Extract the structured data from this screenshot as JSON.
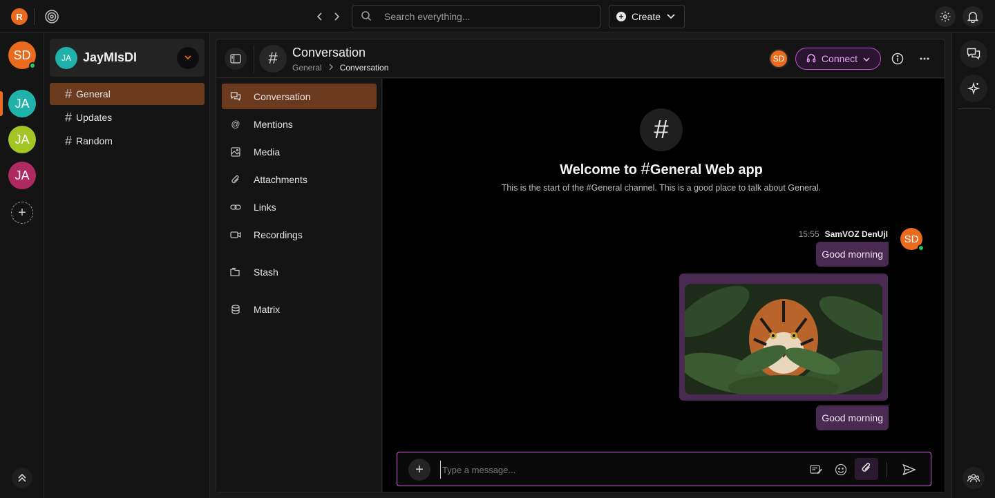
{
  "topbar": {
    "logo_letter": "R",
    "search_placeholder": "Search everything...",
    "create_label": "Create"
  },
  "rail": {
    "user_avatar": "SD",
    "workspaces": [
      {
        "initials": "JA",
        "color": "#20b2aa"
      },
      {
        "initials": "JA",
        "color": "#a3c526"
      },
      {
        "initials": "JA",
        "color": "#b02a62"
      }
    ]
  },
  "sidebar": {
    "workspace_initials": "JA",
    "workspace_name": "JayMIsDI",
    "channels": [
      {
        "name": "General"
      },
      {
        "name": "Updates"
      },
      {
        "name": "Random"
      }
    ]
  },
  "header": {
    "title": "Conversation",
    "breadcrumb": [
      "General",
      "Conversation"
    ],
    "avatar": "SD",
    "connect_label": "Connect"
  },
  "subnav": [
    {
      "label": "Conversation",
      "icon": "chat-icon"
    },
    {
      "label": "Mentions",
      "icon": "at-icon"
    },
    {
      "label": "Media",
      "icon": "image-icon"
    },
    {
      "label": "Attachments",
      "icon": "paperclip-icon"
    },
    {
      "label": "Links",
      "icon": "link-icon"
    },
    {
      "label": "Recordings",
      "icon": "video-icon"
    },
    {
      "label": "Stash",
      "icon": "folder-icon"
    },
    {
      "label": "Matrix",
      "icon": "database-icon"
    }
  ],
  "chat": {
    "welcome_prefix": "Welcome to",
    "welcome_channel": "General Web app",
    "welcome_sub": "This is the start of the #General channel. This is a good place to talk about General.",
    "message": {
      "time": "15:55",
      "author": "SamVOZ DenUjI",
      "avatar": "SD",
      "first_text": "Good morning",
      "second_text": "Good morning"
    }
  },
  "composer": {
    "placeholder": "Type a message..."
  },
  "colors": {
    "accent": "#ea6a1e",
    "active_nav": "#6b3a1e",
    "bubble": "#4a2a52",
    "connect_border": "#c04fd6"
  }
}
